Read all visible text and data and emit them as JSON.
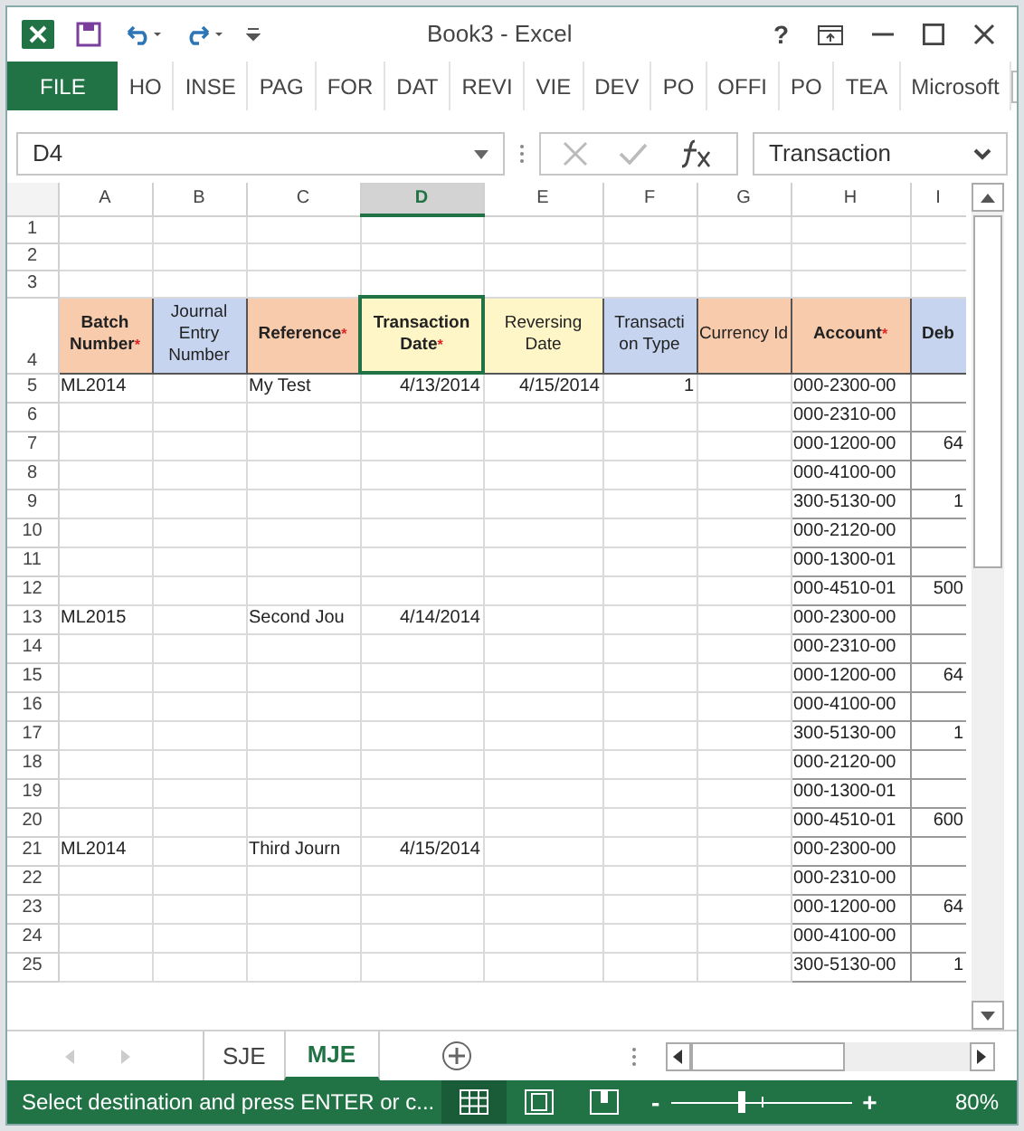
{
  "window": {
    "title": "Book3 - Excel",
    "help": "?"
  },
  "ribbon_tabs": [
    {
      "label": "FILE",
      "kind": "file"
    },
    {
      "label": "HO",
      "kind": "tab"
    },
    {
      "label": "INSE",
      "kind": "tab"
    },
    {
      "label": "PAG",
      "kind": "tab"
    },
    {
      "label": "FOR",
      "kind": "tab"
    },
    {
      "label": "DAT",
      "kind": "tab"
    },
    {
      "label": "REVI",
      "kind": "tab"
    },
    {
      "label": "VIE",
      "kind": "tab"
    },
    {
      "label": "DEV",
      "kind": "tab"
    },
    {
      "label": "PO",
      "kind": "tab"
    },
    {
      "label": "OFFI",
      "kind": "tab"
    },
    {
      "label": "PO",
      "kind": "tab"
    },
    {
      "label": "TEA",
      "kind": "tab"
    },
    {
      "label": "Microsoft",
      "kind": "tab"
    }
  ],
  "formula_bar": {
    "name_box": "D4",
    "value": "Transaction"
  },
  "columns": [
    {
      "letter": "A",
      "selected": false
    },
    {
      "letter": "B",
      "selected": false
    },
    {
      "letter": "C",
      "selected": false
    },
    {
      "letter": "D",
      "selected": true
    },
    {
      "letter": "E",
      "selected": false
    },
    {
      "letter": "F",
      "selected": false
    },
    {
      "letter": "G",
      "selected": false
    },
    {
      "letter": "H",
      "selected": false
    },
    {
      "letter": "I",
      "selected": false
    }
  ],
  "header_row": {
    "number": "4",
    "cells": [
      {
        "label": "Batch Number",
        "mark": "*",
        "bold": true,
        "color": "#f8cbad",
        "selected": false
      },
      {
        "label": "Journal Entry Number",
        "bold": false,
        "color": "#c6d4ef",
        "selected": false
      },
      {
        "label": "Reference",
        "mark": "*",
        "bold": true,
        "color": "#f8cbad",
        "selected": false
      },
      {
        "label": "Transaction Date",
        "mark": "*",
        "bold": true,
        "color": "#fff6c8",
        "selected": true
      },
      {
        "label": "Reversing Date",
        "bold": false,
        "color": "#fff6c8",
        "selected": false
      },
      {
        "label": "Transacti on Type",
        "bold": false,
        "color": "#c6d4ef",
        "selected": false
      },
      {
        "label": "Currency Id",
        "bold": false,
        "color": "#f8cbad",
        "selected": false
      },
      {
        "label": "Account",
        "mark": "*",
        "bold": true,
        "color": "#f8cbad",
        "selected": false
      },
      {
        "label": "Deb",
        "bold": true,
        "color": "#c6d4ef",
        "selected": false
      }
    ]
  },
  "empty_rows": [
    "1",
    "2",
    "3"
  ],
  "rows": [
    {
      "number": "5",
      "cells": [
        "ML2014",
        "",
        "My Test",
        "4/13/2014",
        "4/15/2014",
        "1",
        "",
        "000-2300-00",
        ""
      ]
    },
    {
      "number": "6",
      "cells": [
        "",
        "",
        "",
        "",
        "",
        "",
        "",
        "000-2310-00",
        ""
      ]
    },
    {
      "number": "7",
      "cells": [
        "",
        "",
        "",
        "",
        "",
        "",
        "",
        "000-1200-00",
        "64"
      ]
    },
    {
      "number": "8",
      "cells": [
        "",
        "",
        "",
        "",
        "",
        "",
        "",
        "000-4100-00",
        ""
      ]
    },
    {
      "number": "9",
      "cells": [
        "",
        "",
        "",
        "",
        "",
        "",
        "",
        "300-5130-00",
        "1"
      ]
    },
    {
      "number": "10",
      "cells": [
        "",
        "",
        "",
        "",
        "",
        "",
        "",
        "000-2120-00",
        ""
      ]
    },
    {
      "number": "11",
      "cells": [
        "",
        "",
        "",
        "",
        "",
        "",
        "",
        "000-1300-01",
        ""
      ]
    },
    {
      "number": "12",
      "cells": [
        "",
        "",
        "",
        "",
        "",
        "",
        "",
        "000-4510-01",
        "500"
      ]
    },
    {
      "number": "13",
      "cells": [
        "ML2015",
        "",
        "Second Jou",
        "4/14/2014",
        "",
        "",
        "",
        "000-2300-00",
        ""
      ]
    },
    {
      "number": "14",
      "cells": [
        "",
        "",
        "",
        "",
        "",
        "",
        "",
        "000-2310-00",
        ""
      ]
    },
    {
      "number": "15",
      "cells": [
        "",
        "",
        "",
        "",
        "",
        "",
        "",
        "000-1200-00",
        "64"
      ]
    },
    {
      "number": "16",
      "cells": [
        "",
        "",
        "",
        "",
        "",
        "",
        "",
        "000-4100-00",
        ""
      ]
    },
    {
      "number": "17",
      "cells": [
        "",
        "",
        "",
        "",
        "",
        "",
        "",
        "300-5130-00",
        "1"
      ]
    },
    {
      "number": "18",
      "cells": [
        "",
        "",
        "",
        "",
        "",
        "",
        "",
        "000-2120-00",
        ""
      ]
    },
    {
      "number": "19",
      "cells": [
        "",
        "",
        "",
        "",
        "",
        "",
        "",
        "000-1300-01",
        ""
      ]
    },
    {
      "number": "20",
      "cells": [
        "",
        "",
        "",
        "",
        "",
        "",
        "",
        "000-4510-01",
        "600"
      ]
    },
    {
      "number": "21",
      "cells": [
        "ML2014",
        "",
        "Third Journ",
        "4/15/2014",
        "",
        "",
        "",
        "000-2300-00",
        ""
      ]
    },
    {
      "number": "22",
      "cells": [
        "",
        "",
        "",
        "",
        "",
        "",
        "",
        "000-2310-00",
        ""
      ]
    },
    {
      "number": "23",
      "cells": [
        "",
        "",
        "",
        "",
        "",
        "",
        "",
        "000-1200-00",
        "64"
      ]
    },
    {
      "number": "24",
      "cells": [
        "",
        "",
        "",
        "",
        "",
        "",
        "",
        "000-4100-00",
        ""
      ]
    },
    {
      "number": "25",
      "cells": [
        "",
        "",
        "",
        "",
        "",
        "",
        "",
        "300-5130-00",
        "1"
      ]
    }
  ],
  "sheet_tabs": [
    {
      "label": "SJE",
      "selected": false
    },
    {
      "label": "MJE",
      "selected": true
    }
  ],
  "status_bar": {
    "message": "Select destination and press ENTER or c...",
    "views": [
      {
        "kind": "normal",
        "selected": true
      },
      {
        "kind": "page_layout",
        "selected": false
      },
      {
        "kind": "page_break",
        "selected": false
      }
    ],
    "zoom": {
      "minus": "-",
      "plus": "+",
      "level": 0.39,
      "reading": "80%"
    }
  }
}
